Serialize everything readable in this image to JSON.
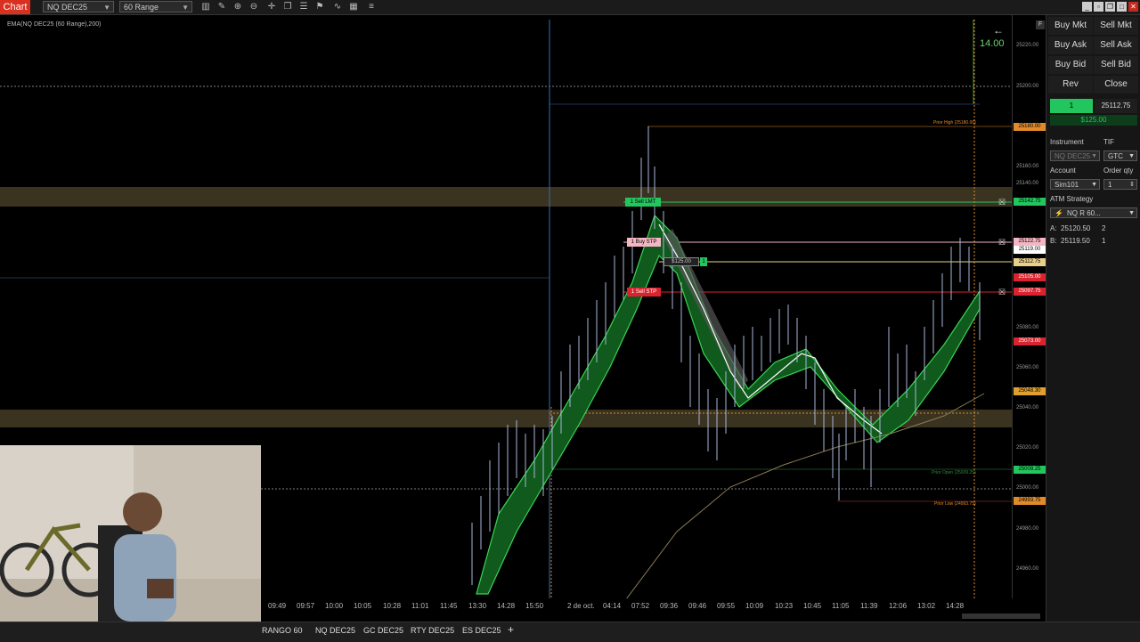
{
  "toolbar": {
    "chart_tab": "Chart",
    "instrument": "NQ DEC25",
    "period": "60 Range",
    "icons": [
      "bar-chart-icon",
      "pencil-icon",
      "zoom-in-icon",
      "zoom-out-icon",
      "crosshair-icon",
      "template-icon",
      "properties-icon",
      "strategy-icon",
      "indicator-icon",
      "data-box-icon",
      "list-icon"
    ]
  },
  "chart": {
    "indicator_label": "EMA(NQ DEC25 (60 Range),200)",
    "corner_value": "14.00",
    "orders": {
      "sell_lmt": "1 Sell LMT",
      "buy_stp": "1 Buy STP",
      "sell_stp": "1 Sell STP",
      "position_pnl": "$125.00",
      "position_qty": "1"
    },
    "annotations": {
      "prior_high": "Prior High (25180.00)",
      "prior_open": "Prior Open (25009.25)",
      "prior_low": "Prior Low (24993.75)"
    }
  },
  "price_axis": {
    "labels": [
      "25220.00",
      "25200.00",
      "25160.00",
      "25140.00",
      "25080.00",
      "25060.00",
      "25040.00",
      "25020.00",
      "25000.00",
      "24980.00",
      "24960.00"
    ],
    "tags": [
      {
        "text": "25180.00",
        "color": "#e08a2a"
      },
      {
        "text": "25142.75",
        "color": "#22c55e"
      },
      {
        "text": "25122.75",
        "color": "#f4b6c2"
      },
      {
        "text": "25119.00",
        "color": "#ffffff"
      },
      {
        "text": "25112.75",
        "color": "#e9cf8a"
      },
      {
        "text": "25105.00",
        "color": "#d9232e"
      },
      {
        "text": "25097.75",
        "color": "#d9232e"
      },
      {
        "text": "25073.00",
        "color": "#d9232e"
      },
      {
        "text": "25048.30",
        "color": "#e0a030"
      },
      {
        "text": "25009.25",
        "color": "#22c55e"
      },
      {
        "text": "24993.75",
        "color": "#e08a2a"
      }
    ]
  },
  "time_axis": [
    "09:49",
    "09:57",
    "10:00",
    "10:05",
    "10:28",
    "11:01",
    "11:45",
    "13:30",
    "14:28",
    "15:50",
    "2 de oct.",
    "04:14",
    "07:52",
    "09:36",
    "09:46",
    "09:55",
    "10:09",
    "10:23",
    "10:45",
    "11:05",
    "11:39",
    "12:06",
    "13:02",
    "14:28"
  ],
  "bottom_tabs": [
    "RANGO 60",
    "NQ DEC25",
    "GC DEC25",
    "RTY DEC25",
    "ES DEC25",
    "+"
  ],
  "panel": {
    "buy_mkt": "Buy Mkt",
    "sell_mkt": "Sell Mkt",
    "buy_ask": "Buy Ask",
    "sell_ask": "Sell Ask",
    "buy_bid": "Buy Bid",
    "sell_bid": "Sell Bid",
    "rev": "Rev",
    "close": "Close",
    "position_qty": "1",
    "position_price": "25112.75",
    "pnl": "$125.00",
    "instrument_label": "Instrument",
    "tif_label": "TIF",
    "instrument_value": "NQ DEC25",
    "tif_value": "GTC",
    "account_label": "Account",
    "order_qty_label": "Order qty",
    "account_value": "Sim101",
    "order_qty_value": "1",
    "atm_label": "ATM Strategy",
    "atm_value": "NQ R 60...",
    "ask_label": "A:",
    "ask_price": "25120.50",
    "ask_qty": "2",
    "bid_label": "B:",
    "bid_price": "25119.50",
    "bid_qty": "1"
  },
  "colors": {
    "accent_red": "#d9301f",
    "buy_green": "#22c55e",
    "background": "#000000"
  }
}
